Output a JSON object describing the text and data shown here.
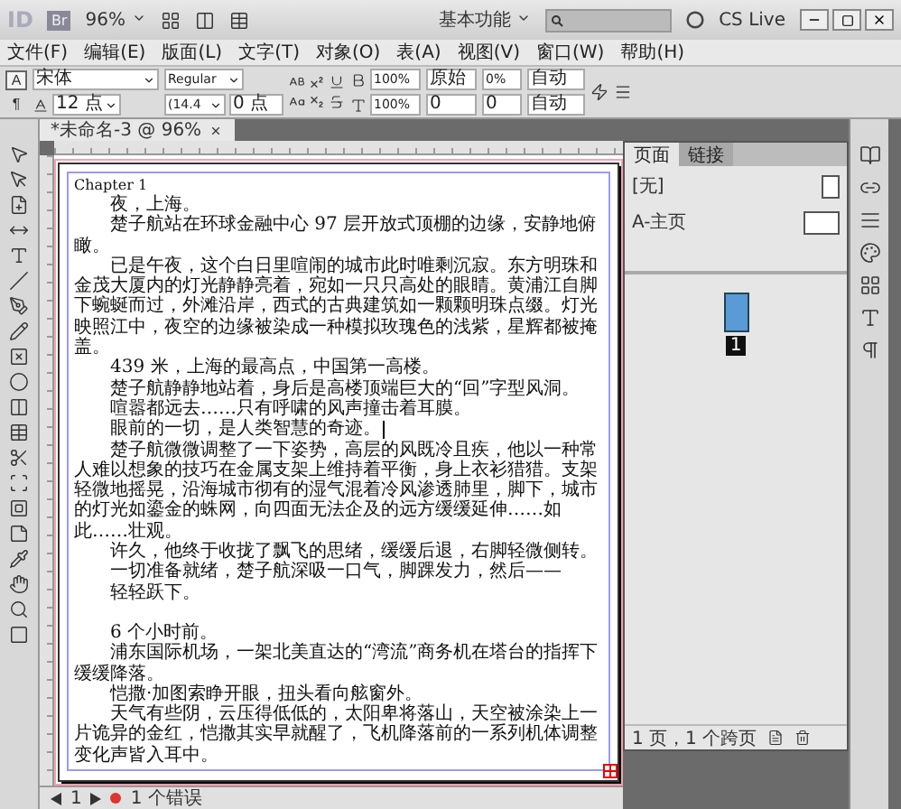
{
  "app_bar": {
    "logo": "ID",
    "bridge": "Br",
    "zoom": "96%",
    "workspace": "基本功能",
    "cs_live": "CS Live"
  },
  "menu": [
    "文件(F)",
    "编辑(E)",
    "版面(L)",
    "文字(T)",
    "对象(O)",
    "表(A)",
    "视图(V)",
    "窗口(W)",
    "帮助(H)"
  ],
  "control_panel": {
    "modes": [
      {
        "label": "A",
        "selected": true
      },
      {
        "label": "¶",
        "selected": false
      }
    ],
    "font": "宋体",
    "style": "Regular",
    "size": "12 点",
    "leading": "(14.4",
    "tracking": "0 点",
    "vertical_scale": "100%",
    "horizontal_scale": "100%",
    "kerning_method": "原始",
    "kerning": "0",
    "baseline_shift": "0%",
    "skew": "0",
    "line_auto_1": "自动",
    "line_auto_2": "自动"
  },
  "document_tab": {
    "title": "*未命名-3 @ 96%"
  },
  "text_frame": {
    "overset": true,
    "paragraphs": [
      {
        "kind": "heading",
        "text": "Chapter 1"
      },
      {
        "kind": "body",
        "text": "夜，上海。"
      },
      {
        "kind": "body",
        "text": "楚子航站在环球金融中心 97 层开放式顶棚的边缘，安静地俯瞰。"
      },
      {
        "kind": "body",
        "text": "已是午夜，这个白日里喧闹的城市此时唯剩沉寂。东方明珠和金茂大厦内的灯光静静亮着，宛如一只只高处的眼睛。黄浦江自脚下蜿蜒而过，外滩沿岸，西式的古典建筑如一颗颗明珠点缀。灯光映照江中，夜空的边缘被染成一种模拟玫瑰色的浅紫，星辉都被掩盖。"
      },
      {
        "kind": "body",
        "text": "439 米，上海的最高点，中国第一高楼。"
      },
      {
        "kind": "body",
        "text": "楚子航静静地站着，身后是高楼顶端巨大的“回”字型风洞。"
      },
      {
        "kind": "body",
        "text": "喧嚣都远去……只有呼啸的风声撞击着耳膜。"
      },
      {
        "kind": "body",
        "text": "眼前的一切，是人类智慧的奇迹。",
        "cursor": true
      },
      {
        "kind": "body",
        "text": "楚子航微微调整了一下姿势，高层的风既冷且疾，他以一种常人难以想象的技巧在金属支架上维持着平衡，身上衣衫猎猎。支架轻微地摇晃，沿海城市彻有的湿气混着冷风渗透肺里，脚下，城市的灯光如鎏金的蛛网，向四面无法企及的远方缓缓延伸……如此……壮观。"
      },
      {
        "kind": "body",
        "text": "许久，他终于收拢了飘飞的思绪，缓缓后退，右脚轻微侧转。"
      },
      {
        "kind": "body",
        "text": "一切准备就绪，楚子航深吸一口气，脚踝发力，然后——"
      },
      {
        "kind": "body",
        "text": "轻轻跃下。"
      },
      {
        "kind": "break"
      },
      {
        "kind": "body",
        "text": "6 个小时前。"
      },
      {
        "kind": "body",
        "text": "浦东国际机场，一架北美直达的“湾流”商务机在塔台的指挥下缓缓降落。"
      },
      {
        "kind": "body",
        "text": "恺撒·加图索睁开眼，扭头看向舷窗外。"
      },
      {
        "kind": "body",
        "text": "天气有些阴，云压得低低的，太阳卑将落山，天空被涂染上一片诡异的金红，恺撒其实早就醒了，飞机降落前的一系列机体调整变化声皆入耳中。"
      }
    ]
  },
  "pages_panel": {
    "tabs": [
      {
        "label": "页面",
        "selected": true
      },
      {
        "label": "链接",
        "selected": false
      }
    ],
    "masters": [
      "[无]",
      "A-主页"
    ],
    "page_number": "1",
    "footer": "1 页，1 个跨页"
  },
  "status_bar": {
    "page": "1",
    "errors": "1 个错误"
  }
}
